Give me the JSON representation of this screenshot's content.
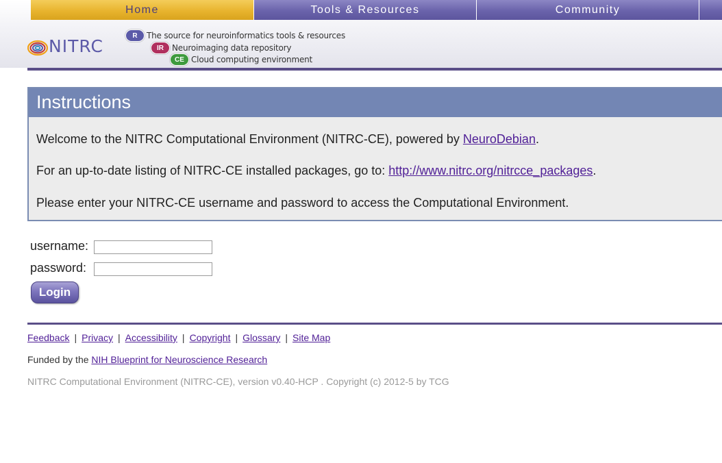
{
  "nav": {
    "tabs": [
      {
        "label": "Home",
        "active": true
      },
      {
        "label": "Tools & Resources",
        "active": false
      },
      {
        "label": "Community",
        "active": false
      },
      {
        "label": "",
        "active": false
      }
    ]
  },
  "logo": {
    "text": "NITRC",
    "taglines": [
      {
        "badge": "R",
        "text": "The source for neuroinformatics tools & resources",
        "color": "#5b5aa8"
      },
      {
        "badge": "IR",
        "text": "Neuroimaging data repository",
        "color": "#b0305e"
      },
      {
        "badge": "CE",
        "text": "Cloud computing environment",
        "color": "#3e9a3e"
      }
    ]
  },
  "instructions": {
    "title": "Instructions",
    "line1_prefix": "Welcome to the NITRC Computational Environment (NITRC-CE), powered by ",
    "line1_link": "NeuroDebian",
    "line1_suffix": ".",
    "line2_prefix": "For an up-to-date listing of NITRC-CE installed packages, go to: ",
    "line2_link": "http://www.nitrc.org/nitrcce_packages",
    "line2_suffix": ".",
    "line3": "Please enter your NITRC-CE username and password to access the Computational Environment."
  },
  "login": {
    "username_label": "username:",
    "username_value": "",
    "password_label": "password:",
    "password_value": "",
    "button_label": "Login"
  },
  "footer": {
    "links": [
      "Feedback",
      "Privacy",
      "Accessibility",
      "Copyright",
      "Glossary",
      "Site Map"
    ],
    "separator": "|",
    "funded_prefix": "Funded by the ",
    "funded_link": "NIH Blueprint for Neuroscience Research",
    "copyright": "NITRC Computational Environment (NITRC-CE), version v0.40-HCP . Copyright (c) 2012-5 by TCG"
  },
  "colors": {
    "brand_purple": "#5a4e88",
    "nav_active": "#e8b42e",
    "nav_inactive": "#6a63ab",
    "instructions_header": "#7386b4",
    "link": "#4f1e96"
  }
}
